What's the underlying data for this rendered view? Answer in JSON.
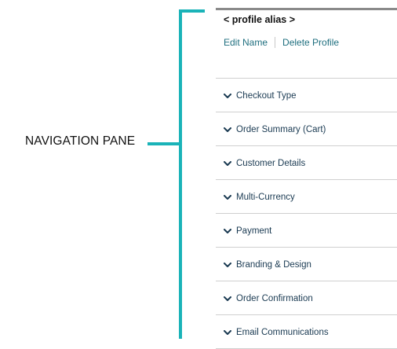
{
  "callout": {
    "label": "NAVIGATION PANE",
    "color": "#1ab3b8"
  },
  "panel": {
    "profile_alias": "< profile alias >",
    "actions": {
      "edit": "Edit Name",
      "delete": "Delete Profile"
    },
    "nav_items": [
      {
        "label": "Checkout Type",
        "icon": "chevron-down-icon"
      },
      {
        "label": "Order Summary (Cart)",
        "icon": "chevron-down-icon"
      },
      {
        "label": "Customer Details",
        "icon": "chevron-down-icon"
      },
      {
        "label": "Multi-Currency",
        "icon": "chevron-down-icon"
      },
      {
        "label": "Payment",
        "icon": "chevron-down-icon"
      },
      {
        "label": "Branding & Design",
        "icon": "chevron-down-icon"
      },
      {
        "label": "Order Confirmation",
        "icon": "chevron-down-icon"
      },
      {
        "label": "Email Communications",
        "icon": "chevron-down-icon"
      }
    ],
    "colors": {
      "link": "#1f6f7f",
      "nav_text": "#1a3a52",
      "divider": "#cfcfcf"
    }
  }
}
